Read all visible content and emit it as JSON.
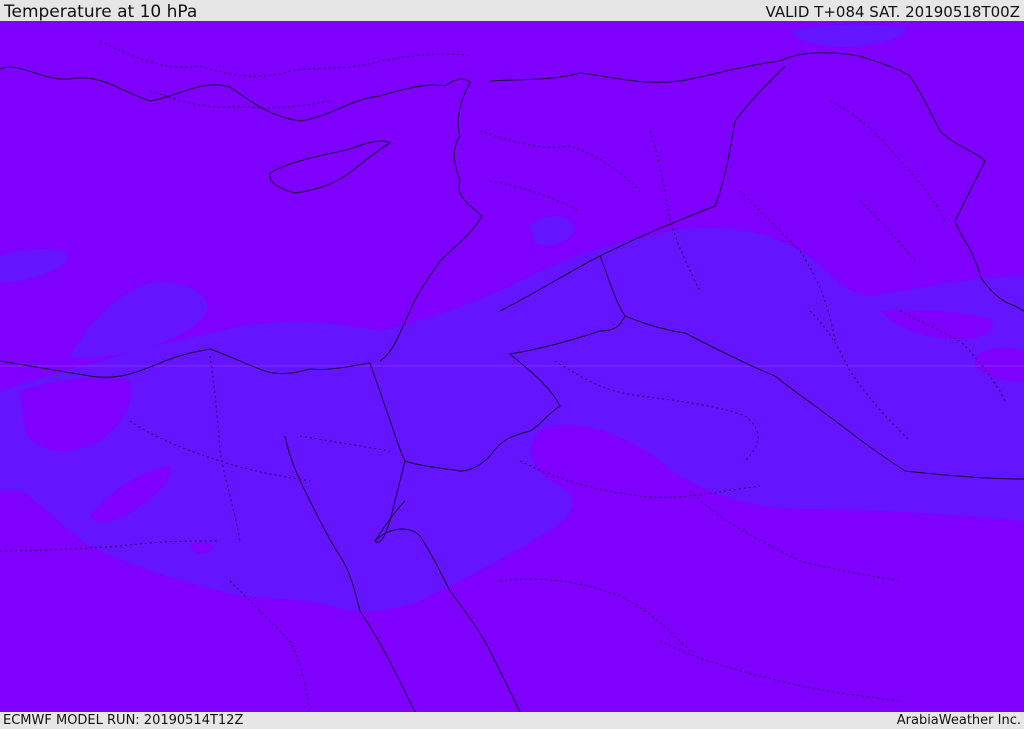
{
  "header": {
    "title": "Temperature at 10 hPa",
    "valid": "VALID T+084 SAT. 20190518T00Z"
  },
  "footer": {
    "model_run": "ECMWF MODEL RUN: 20190514T12Z",
    "credit": "ArabiaWeather Inc."
  },
  "map": {
    "field": "temperature",
    "level": "10 hPa",
    "colors": {
      "background_field": "#7f00ff",
      "warmer_field": "#6414ff",
      "coastline": "#1a0033",
      "border": "#1a0033"
    }
  }
}
